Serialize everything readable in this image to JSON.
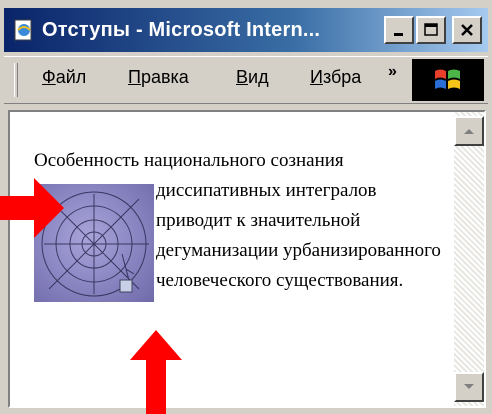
{
  "window": {
    "title": "Отступы - Microsoft Intern..."
  },
  "menu": {
    "items": [
      {
        "label": "Файл",
        "accel": "Ф",
        "rest": "айл"
      },
      {
        "label": "Правка",
        "accel": "П",
        "rest": "равка"
      },
      {
        "label": "Вид",
        "accel": "В",
        "rest": "ид"
      },
      {
        "label": "Избра",
        "accel": "И",
        "rest": "збра"
      }
    ],
    "overflow": "»"
  },
  "document": {
    "paragraph": "Особенность национального сознания диссипативных интегралов приводит к значительной дегуманизации урбанизированного человеческого существования."
  },
  "colors": {
    "titlebar_start": "#0a246a",
    "arrow": "#ff0000",
    "face": "#d4d0c8"
  },
  "icons": {
    "app": "ie-page-icon",
    "minimize": "minimize-icon",
    "maximize": "maximize-icon",
    "close": "close-icon",
    "logo": "windows-logo-icon",
    "scroll_up": "scroll-up-arrow-icon",
    "scroll_down": "scroll-down-arrow-icon"
  }
}
